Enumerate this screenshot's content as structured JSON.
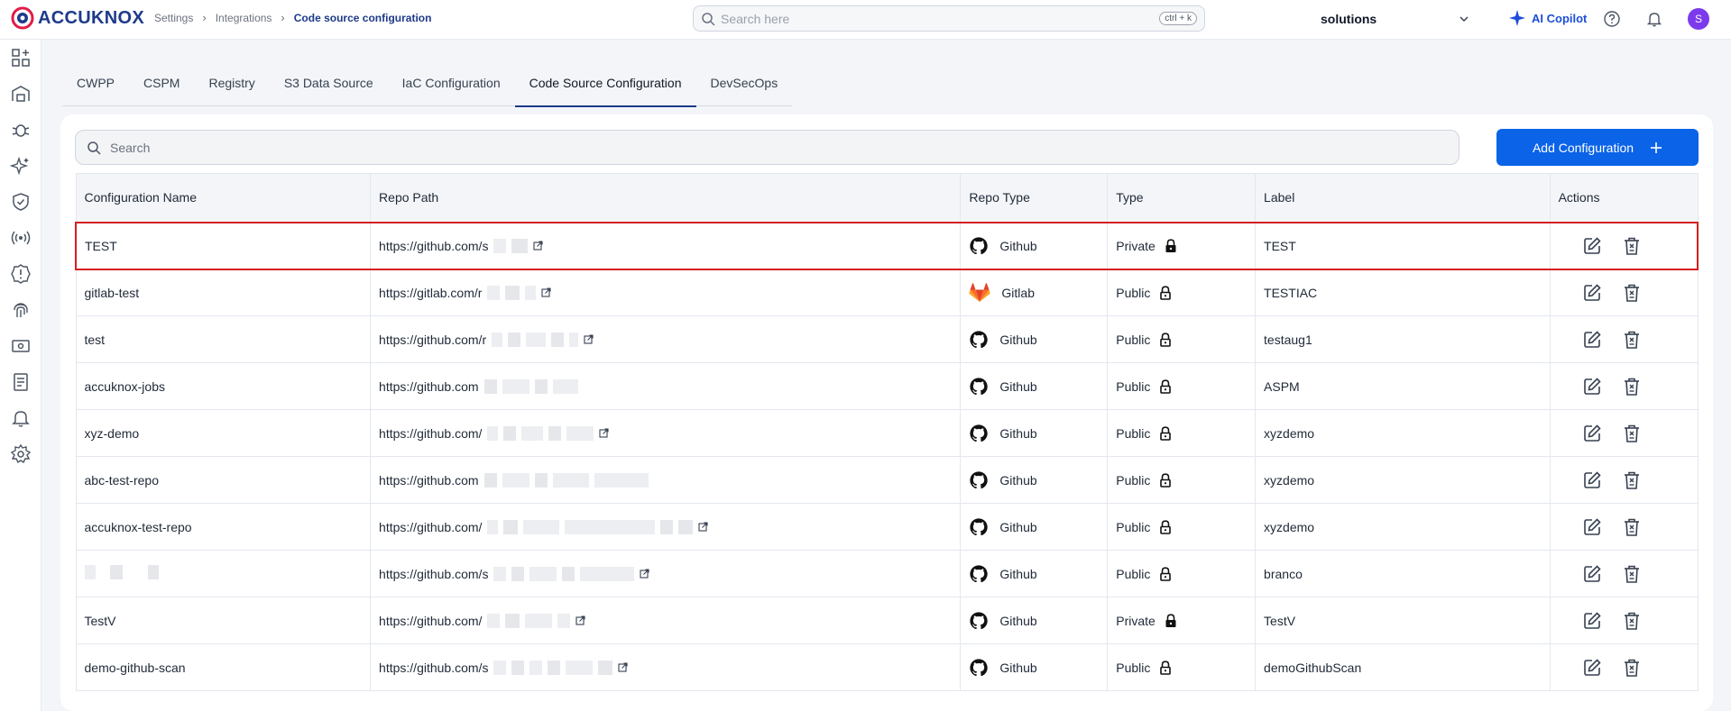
{
  "header": {
    "logo_text": "ACCUKNOX",
    "breadcrumb": [
      "Settings",
      "Integrations",
      "Code source configuration"
    ],
    "search_placeholder": "Search here",
    "search_shortcut": "ctrl + k",
    "org": "solutions",
    "copilot_label": "AI Copilot",
    "avatar_initial": "S"
  },
  "sidebar": {
    "icons": [
      "dashboard-icon",
      "inventory-icon",
      "bug-icon",
      "sparkle-icon",
      "shield-icon",
      "broadcast-icon",
      "alert-icon",
      "fingerprint-icon",
      "ticket-icon",
      "report-icon",
      "bell-icon",
      "gear-icon"
    ]
  },
  "tabs": [
    {
      "label": "CWPP",
      "active": false
    },
    {
      "label": "CSPM",
      "active": false
    },
    {
      "label": "Registry",
      "active": false
    },
    {
      "label": "S3 Data Source",
      "active": false
    },
    {
      "label": "IaC Configuration",
      "active": false
    },
    {
      "label": "Code Source Configuration",
      "active": true
    },
    {
      "label": "DevSecOps",
      "active": false
    }
  ],
  "table_search_placeholder": "Search",
  "add_button_label": "Add Configuration",
  "columns": [
    "Configuration Name",
    "Repo Path",
    "Repo Type",
    "Type",
    "Label",
    "Actions"
  ],
  "rows": [
    {
      "name": "TEST",
      "repo_path": "https://github.com/s",
      "repo_type": "Github",
      "type": "Private",
      "label": "TEST",
      "selected": true
    },
    {
      "name": "gitlab-test",
      "repo_path": "https://gitlab.com/r",
      "repo_type": "Gitlab",
      "type": "Public",
      "label": "TESTIAC",
      "selected": false
    },
    {
      "name": "test",
      "repo_path": "https://github.com/r",
      "repo_type": "Github",
      "type": "Public",
      "label": "testaug1",
      "selected": false
    },
    {
      "name": "accuknox-jobs",
      "repo_path": "https://github.com",
      "repo_type": "Github",
      "type": "Public",
      "label": "ASPM",
      "selected": false
    },
    {
      "name": "xyz-demo",
      "repo_path": "https://github.com/",
      "repo_type": "Github",
      "type": "Public",
      "label": "xyzdemo",
      "selected": false
    },
    {
      "name": "abc-test-repo",
      "repo_path": "https://github.com",
      "repo_type": "Github",
      "type": "Public",
      "label": "xyzdemo",
      "selected": false
    },
    {
      "name": "accuknox-test-repo",
      "repo_path": "https://github.com/",
      "repo_type": "Github",
      "type": "Public",
      "label": "xyzdemo",
      "selected": false
    },
    {
      "name": "",
      "repo_path": "https://github.com/s",
      "repo_type": "Github",
      "type": "Public",
      "label": "branco",
      "selected": false
    },
    {
      "name": "TestV",
      "repo_path": "https://github.com/",
      "repo_type": "Github",
      "type": "Private",
      "label": "TestV",
      "selected": false
    },
    {
      "name": "demo-github-scan",
      "repo_path": "https://github.com/s",
      "repo_type": "Github",
      "type": "Public",
      "label": "demoGithubScan",
      "selected": false
    }
  ]
}
